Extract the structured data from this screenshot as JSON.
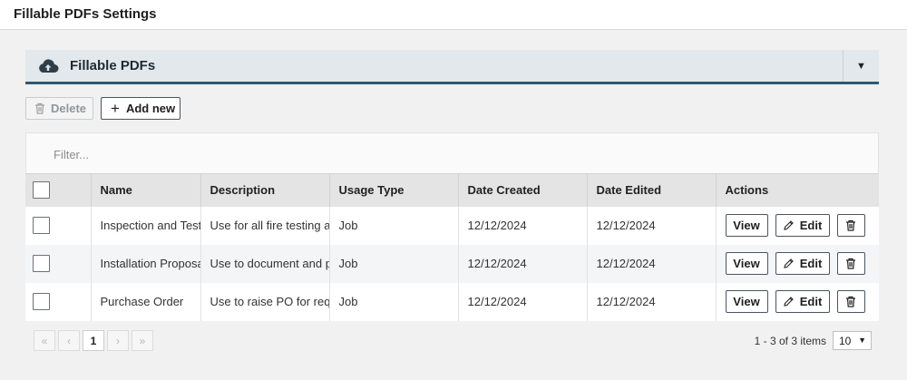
{
  "page": {
    "title": "Fillable PDFs Settings"
  },
  "panel": {
    "title": "Fillable PDFs",
    "icon": "cloud-upload-icon",
    "toggle_glyph": "▼"
  },
  "toolbar": {
    "delete_label": "Delete",
    "add_label": "Add new",
    "add_glyph": "+"
  },
  "filter": {
    "placeholder": "Filter..."
  },
  "table": {
    "headers": [
      "Name",
      "Description",
      "Usage Type",
      "Date Created",
      "Date Edited",
      "Actions"
    ],
    "rows": [
      {
        "name": "Inspection and Test",
        "description": "Use for all fire testing ar",
        "usage_type": "Job",
        "date_created": "12/12/2024",
        "date_edited": "12/12/2024"
      },
      {
        "name": "Installation Proposa",
        "description": "Use to document and pr",
        "usage_type": "Job",
        "date_created": "12/12/2024",
        "date_edited": "12/12/2024"
      },
      {
        "name": "Purchase Order",
        "description": "Use to raise PO for requ",
        "usage_type": "Job",
        "date_created": "12/12/2024",
        "date_edited": "12/12/2024"
      }
    ],
    "actions": {
      "view_label": "View",
      "edit_label": "Edit"
    }
  },
  "pagination": {
    "first_glyph": "«",
    "prev_glyph": "‹",
    "current_page": "1",
    "next_glyph": "›",
    "last_glyph": "»",
    "summary": "1 - 3 of 3 items",
    "page_size": "10",
    "page_size_caret": "▼"
  },
  "colors": {
    "accent": "#2e5978",
    "header_bg": "#e3e8ec"
  }
}
